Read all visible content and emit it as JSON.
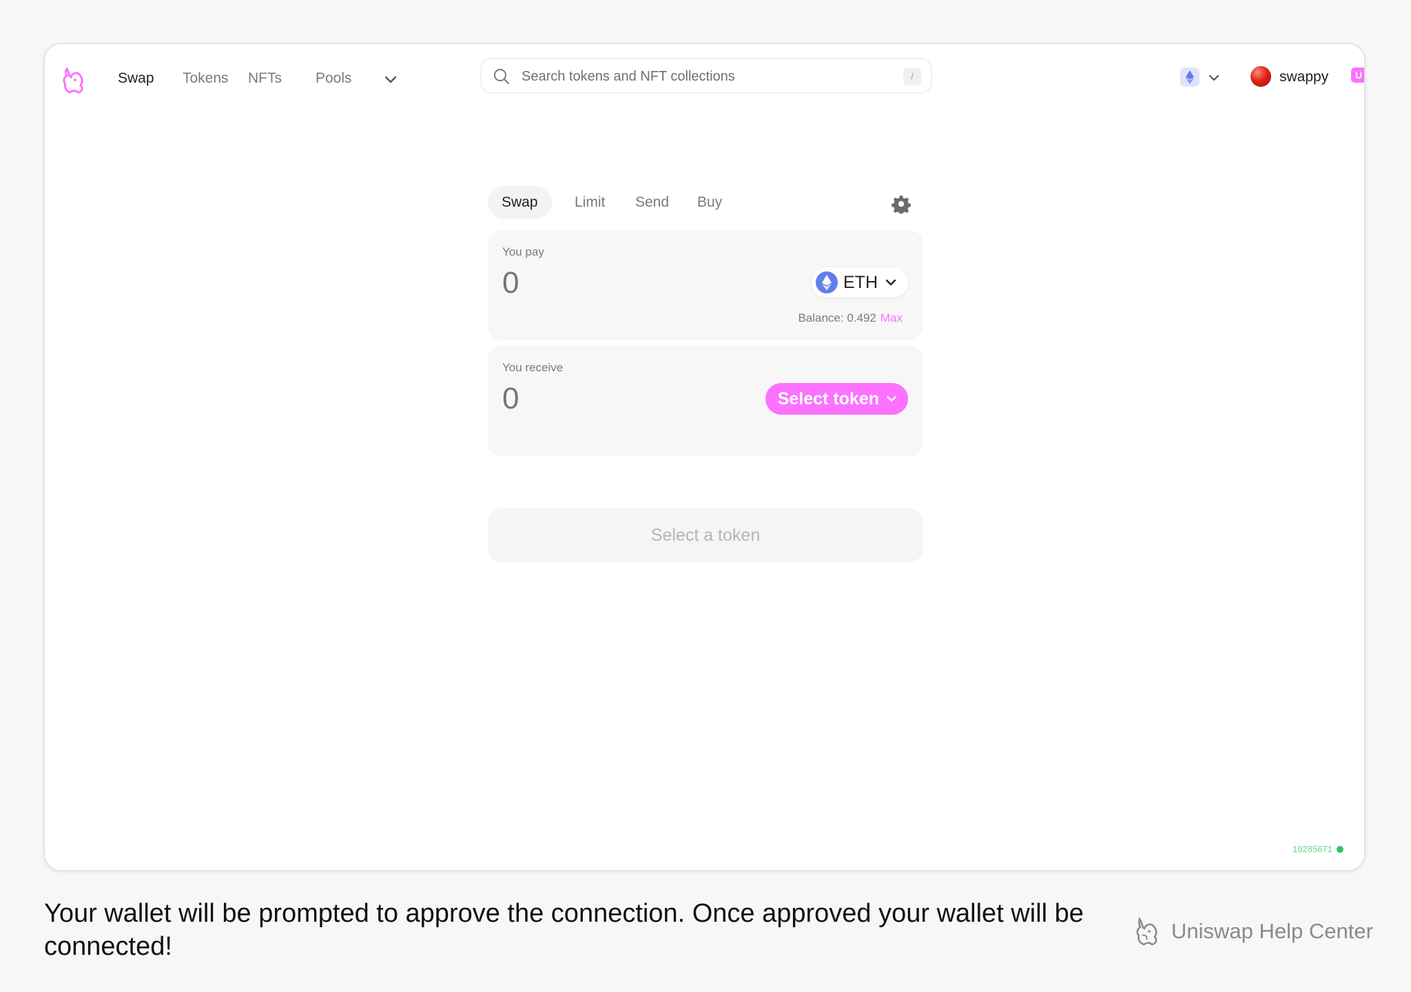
{
  "nav": {
    "links": [
      "Swap",
      "Tokens",
      "NFTs",
      "Pools"
    ],
    "search_placeholder": "Search tokens and NFT collections",
    "search_shortcut": "/",
    "account_name": "swappy",
    "account_badge": "U"
  },
  "widget": {
    "tabs": [
      "Swap",
      "Limit",
      "Send",
      "Buy"
    ],
    "pay": {
      "label": "You pay",
      "amount": "0",
      "token": "ETH",
      "balance_label": "Balance: 0.492",
      "max_label": "Max"
    },
    "receive": {
      "label": "You receive",
      "amount": "0",
      "select_label": "Select token"
    },
    "cta_label": "Select a token"
  },
  "status": {
    "block_number": "19285671"
  },
  "caption": {
    "text": "Your wallet will be prompted to approve the connection. Once approved your wallet will be connected!",
    "brand": "Uniswap Help Center"
  },
  "colors": {
    "accent": "#fc72ff",
    "eth": "#627eea",
    "status_ok": "#33c467"
  }
}
